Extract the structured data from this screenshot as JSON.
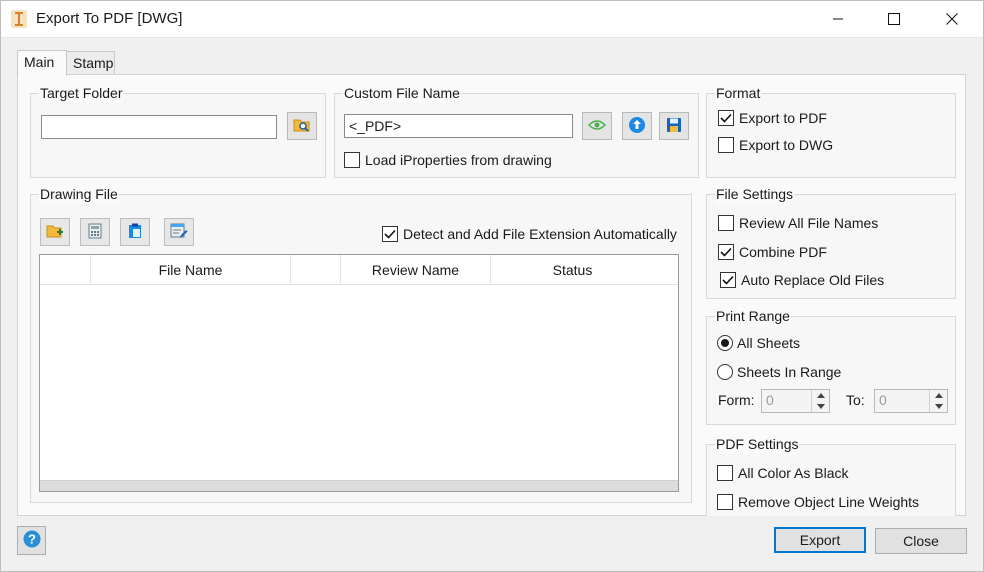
{
  "window": {
    "title": "Export To PDF [DWG]",
    "icon": "app-icon",
    "controls": [
      "minimize-icon",
      "maximize-icon",
      "close-icon"
    ]
  },
  "tabs": [
    {
      "label": "Main",
      "active": true
    },
    {
      "label": "Stamp",
      "active": false
    }
  ],
  "target_folder": {
    "title": "Target Folder",
    "value": "",
    "browse_icon": "folder-search-icon"
  },
  "custom_file_name": {
    "title": "Custom File Name",
    "value": "<_PDF>",
    "buttons": [
      "eye-icon",
      "upload-icon",
      "save-icon"
    ],
    "load_iproperties": {
      "label": "Load iProperties from drawing",
      "checked": false
    }
  },
  "format": {
    "title": "Format",
    "options": [
      {
        "label": "Export to PDF",
        "checked": true
      },
      {
        "label": "Export to DWG",
        "checked": false
      }
    ]
  },
  "drawing_file": {
    "title": "Drawing File",
    "toolbar": [
      "add-folder-icon",
      "calculator-icon",
      "clipboard-icon",
      "edit-list-icon"
    ],
    "detect_extension": {
      "label": "Detect and Add File Extension Automatically",
      "checked": true
    },
    "columns": [
      "",
      "File Name",
      "",
      "Review Name",
      "Status"
    ],
    "rows": []
  },
  "file_settings": {
    "title": "File Settings",
    "options": [
      {
        "label": "Review All File Names",
        "checked": false
      },
      {
        "label": "Combine PDF",
        "checked": true
      },
      {
        "label": "Auto Replace Old Files",
        "checked": true
      }
    ]
  },
  "print_range": {
    "title": "Print Range",
    "options": [
      {
        "label": "All Sheets",
        "selected": true
      },
      {
        "label": "Sheets In Range",
        "selected": false
      }
    ],
    "from_label": "Form:",
    "from_value": "0",
    "to_label": "To:",
    "to_value": "0"
  },
  "pdf_settings": {
    "title": "PDF Settings",
    "options": [
      {
        "label": "All Color As Black",
        "checked": false
      },
      {
        "label": "Remove Object Line Weights",
        "checked": false
      }
    ]
  },
  "footer": {
    "help_icon": "help-icon",
    "export_label": "Export",
    "close_label": "Close"
  },
  "colors": {
    "accent": "#0078d7",
    "help": "#2b8fd6"
  }
}
